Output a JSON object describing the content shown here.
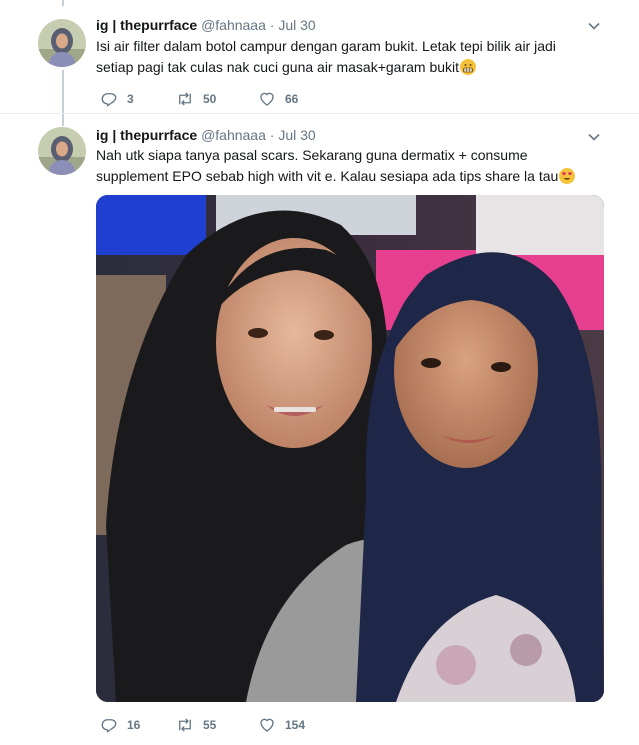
{
  "tweets": [
    {
      "display_name": "ig | thepurrface",
      "handle": "@fahnaaa",
      "separator": "·",
      "time": "Jul 30",
      "text": "Isi air filter dalam botol campur dengan garam bukit. Letak tepi bilik air jadi setiap pagi tak culas nak cuci guna air masak+garam bukit",
      "emoji": "grimacing-face-emoji",
      "replies": "3",
      "retweets": "50",
      "likes": "66"
    },
    {
      "display_name": "ig | thepurrface",
      "handle": "@fahnaaa",
      "separator": "·",
      "time": "Jul 30",
      "text": "Nah utk siapa tanya pasal scars. Sekarang guna dermatix + consume supplement EPO sebab high with vit e. Kalau sesiapa ada tips share la tau",
      "emoji": "heart-eyes-emoji",
      "replies": "16",
      "retweets": "55",
      "likes": "154"
    }
  ],
  "icons": {
    "reply": "reply-icon",
    "retweet": "retweet-icon",
    "like": "heart-icon",
    "menu": "chevron-down-icon"
  },
  "colors": {
    "text_primary": "#14171a",
    "text_secondary": "#657786",
    "thread_line": "#c4cfd6",
    "divider": "#e6ecf0"
  }
}
